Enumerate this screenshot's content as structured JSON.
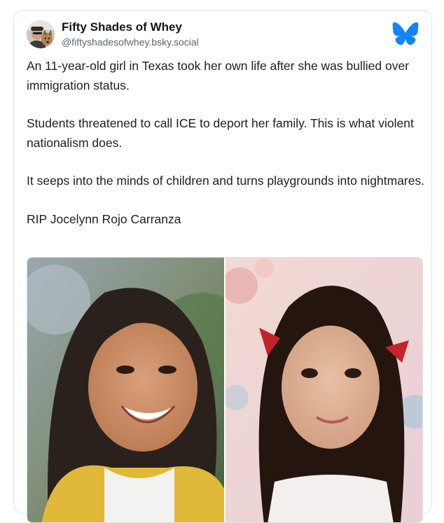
{
  "author": {
    "display_name": "Fifty Shades of Whey",
    "handle": "@fiftyshadesofwhey.bsky.social",
    "avatar_icon": "avatar-photo-icon"
  },
  "platform_icon": "bluesky-butterfly-icon",
  "brand_color": "#1185fe",
  "post": {
    "paragraphs": [
      "An 11-year-old girl in Texas took her own life after she was bullied over immigration status.",
      "Students threatened to call ICE to deport her family. This is what violent nationalism does.",
      "It seeps into the minds of children and turns playgrounds into nightmares.",
      "RIP Jocelynn Rojo Carranza"
    ]
  },
  "media": {
    "images": [
      "photo-left",
      "photo-right"
    ]
  }
}
